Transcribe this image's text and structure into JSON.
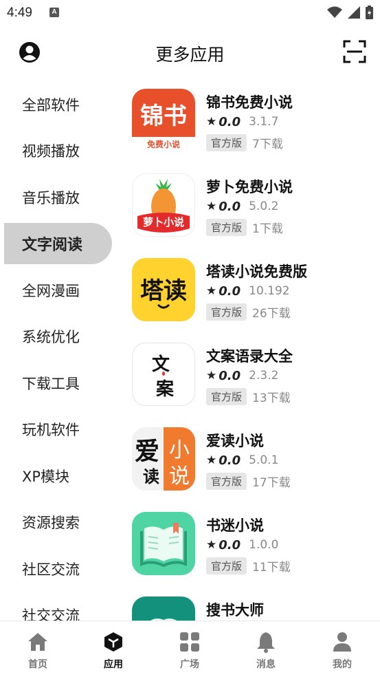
{
  "status_bar": {
    "time": "4:49",
    "notif_glyph": "A"
  },
  "header": {
    "title": "更多应用",
    "left_icon": "account-circle-icon",
    "right_icon": "scan-icon"
  },
  "categories": [
    {
      "label": "全部软件"
    },
    {
      "label": "视频播放"
    },
    {
      "label": "音乐播放"
    },
    {
      "label": "文字阅读",
      "active": true
    },
    {
      "label": "全网漫画"
    },
    {
      "label": "系统优化"
    },
    {
      "label": "下载工具"
    },
    {
      "label": "玩机软件"
    },
    {
      "label": "XP模块"
    },
    {
      "label": "资源搜索"
    },
    {
      "label": "社区交流"
    },
    {
      "label": "社交交流"
    }
  ],
  "apps": [
    {
      "name": "锦书免费小说",
      "star": "★",
      "rating": "0.0",
      "version": "3.1.7",
      "tag": "官方版",
      "downloads": "7下载",
      "icon_text": "锦书",
      "icon_sub": "免费小说",
      "icon_color": "#e8502c"
    },
    {
      "name": "萝卜免费小说",
      "star": "★",
      "rating": "0.0",
      "version": "5.0.2",
      "tag": "官方版",
      "downloads": "1下载",
      "icon_text": "萝卜小说",
      "icon_color": "#e32b2b"
    },
    {
      "name": "塔读小说免费版",
      "star": "★",
      "rating": "0.0",
      "version": "10.192",
      "tag": "官方版",
      "downloads": "26下载",
      "icon_text": "塔读",
      "icon_color": "#ffd22e"
    },
    {
      "name": "文案语录大全",
      "star": "★",
      "rating": "0.0",
      "version": "2.3.2",
      "tag": "官方版",
      "downloads": "13下载",
      "icon_text_1": "文",
      "icon_text_2": "案",
      "icon_color": "#ffffff"
    },
    {
      "name": "爱读小说",
      "star": "★",
      "rating": "0.0",
      "version": "5.0.1",
      "tag": "官方版",
      "downloads": "17下载",
      "icon_text_1": "爱",
      "icon_text_2": "读",
      "icon_text_3": "小",
      "icon_text_4": "说",
      "icon_color": "#f07a2e"
    },
    {
      "name": "书迷小说",
      "star": "★",
      "rating": "0.0",
      "version": "1.0.0",
      "tag": "官方版",
      "downloads": "11下载",
      "icon_color": "#4fd4a4"
    },
    {
      "name": "搜书大师",
      "icon_color": "#13917c"
    }
  ],
  "bottom_nav": [
    {
      "label": "首页",
      "icon": "home-icon"
    },
    {
      "label": "应用",
      "icon": "cube-icon",
      "active": true
    },
    {
      "label": "广场",
      "icon": "grid-icon"
    },
    {
      "label": "消息",
      "icon": "bell-icon"
    },
    {
      "label": "我的",
      "icon": "person-icon"
    }
  ]
}
